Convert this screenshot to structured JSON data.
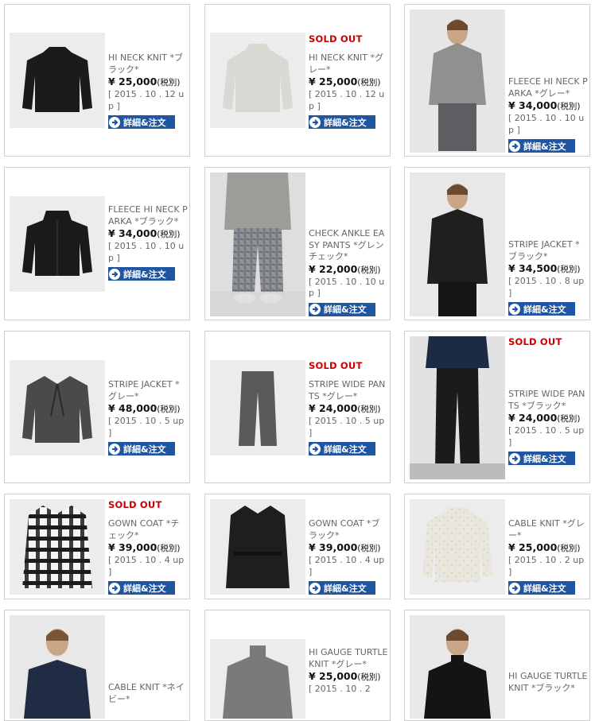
{
  "products": [
    {
      "name": "HI NECK KNIT *ブラック*",
      "price": "¥ 25,000",
      "tax": "(税別)",
      "date": "[ 2015 . 10 . 12 up ]",
      "sold_out": "",
      "button": "詳細&注文",
      "icon": "black-knit"
    },
    {
      "name": "HI NECK KNIT *グレー*",
      "price": "¥ 25,000",
      "tax": "(税別)",
      "date": "[ 2015 . 10 . 12 up ]",
      "sold_out": "SOLD OUT",
      "button": "詳細&注文",
      "icon": "grey-knit"
    },
    {
      "name": "FLEECE HI NECK PARKA *グレー*",
      "price": "¥ 34,000",
      "tax": "(税別)",
      "date": "[ 2015 . 10 . 10 up ]",
      "sold_out": "",
      "button": "詳細&注文",
      "icon": "model-grey-fleece"
    },
    {
      "name": "FLEECE HI NECK PARKA *ブラック*",
      "price": "¥ 34,000",
      "tax": "(税別)",
      "date": "[ 2015 . 10 . 10 up ]",
      "sold_out": "",
      "button": "詳細&注文",
      "icon": "black-fleece"
    },
    {
      "name": "CHECK ANKLE EASY PANTS *グレンチェック*",
      "price": "¥ 22,000",
      "tax": "(税別)",
      "date": "[ 2015 . 10 . 10 up ]",
      "sold_out": "",
      "button": "詳細&注文",
      "icon": "model-check-pants"
    },
    {
      "name": "STRIPE JACKET *ブラック*",
      "price": "¥ 34,500",
      "tax": "(税別)",
      "date": "[ 2015 . 10 . 8 up ]",
      "sold_out": "",
      "button": "詳細&注文",
      "icon": "model-black-jacket"
    },
    {
      "name": "STRIPE JACKET *グレー*",
      "price": "¥ 48,000",
      "tax": "(税別)",
      "date": "[ 2015 . 10 . 5 up ]",
      "sold_out": "",
      "button": "詳細&注文",
      "icon": "grey-jacket"
    },
    {
      "name": "STRIPE WIDE PANTS *グレー*",
      "price": "¥ 24,000",
      "tax": "(税別)",
      "date": "[ 2015 . 10 . 5 up ]",
      "sold_out": "SOLD OUT",
      "button": "詳細&注文",
      "icon": "grey-pants"
    },
    {
      "name": "STRIPE WIDE PANTS *ブラック*",
      "price": "¥ 24,000",
      "tax": "(税別)",
      "date": "[ 2015 . 10 . 5 up ]",
      "sold_out": "SOLD OUT",
      "button": "詳細&注文",
      "icon": "model-black-pants"
    },
    {
      "name": "GOWN COAT *チェック*",
      "price": "¥ 39,000",
      "tax": "(税別)",
      "date": "[ 2015 . 10 . 4 up ]",
      "sold_out": "SOLD OUT",
      "button": "詳細&注文",
      "icon": "check-coat"
    },
    {
      "name": "GOWN COAT *ブラック*",
      "price": "¥ 39,000",
      "tax": "(税別)",
      "date": "[ 2015 . 10 . 4 up ]",
      "sold_out": "",
      "button": "詳細&注文",
      "icon": "black-coat"
    },
    {
      "name": "CABLE KNIT *グレー*",
      "price": "¥ 25,000",
      "tax": "(税別)",
      "date": "[ 2015 . 10 . 2 up ]",
      "sold_out": "",
      "button": "詳細&注文",
      "icon": "cable-knit"
    },
    {
      "name": "CABLE KNIT *ネイビー*",
      "price": "",
      "tax": "",
      "date": "",
      "sold_out": "",
      "button": "",
      "icon": "model-navy-knit"
    },
    {
      "name": "HI GAUGE TURTLE KNIT *グレー*",
      "price": "¥ 25,000",
      "tax": "(税別)",
      "date": "[ 2015 . 10 . 2",
      "sold_out": "",
      "button": "",
      "icon": "model-grey-turtle"
    },
    {
      "name": "HI GAUGE TURTLE KNIT *ブラック*",
      "price": "",
      "tax": "",
      "date": "",
      "sold_out": "",
      "button": "",
      "icon": "model-black-turtle"
    }
  ],
  "colors": {
    "sold_out": "#cc0000",
    "button_bg": "#1f55a1",
    "border": "#cfcfcf",
    "text": "#666666"
  }
}
